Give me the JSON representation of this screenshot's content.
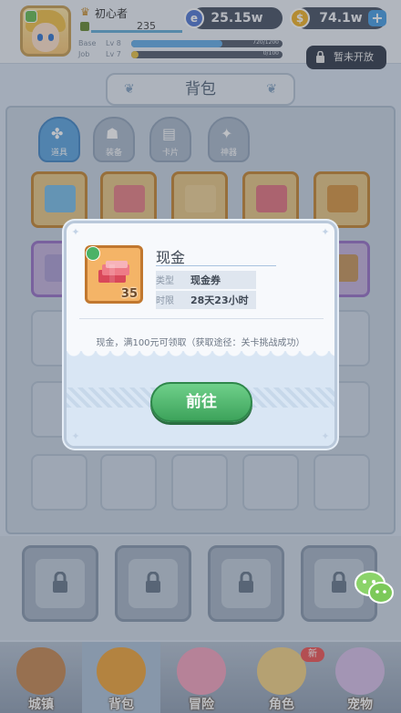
{
  "player": {
    "name": "初心者",
    "exp_value": "235"
  },
  "stats": [
    {
      "label": "Base",
      "level": "Lv 8",
      "bar_text": "720/1200",
      "fill": 0.6,
      "color": "#6ab0e8"
    },
    {
      "label": "Job",
      "level": "Lv 7",
      "bar_text": "0/100",
      "fill": 0.05,
      "color": "#e7c34c"
    }
  ],
  "currencies": [
    {
      "name": "diamond",
      "value": "25.15w",
      "icon": "e",
      "color": "#5a7fd6"
    },
    {
      "name": "gold",
      "value": "74.1w",
      "icon": "$",
      "color": "#f1b52e"
    }
  ],
  "locked_chip": "暂未开放",
  "bag": {
    "title": "背包"
  },
  "tabs": [
    {
      "label": "道具",
      "icon": "✤",
      "active": true
    },
    {
      "label": "装备",
      "icon": "☗",
      "active": false
    },
    {
      "label": "卡片",
      "icon": "▤",
      "active": false
    },
    {
      "label": "神器",
      "icon": "✦",
      "active": false
    }
  ],
  "modal": {
    "item_name": "现金",
    "quantity": "35",
    "type_label": "类型",
    "type_value": "现金券",
    "time_label": "时限",
    "time_value": "28天23小时",
    "description": "现金，满100元可领取（获取途径：关卡挑战成功）",
    "button_label": "前往"
  },
  "nav": [
    {
      "label": "城镇",
      "icon": "castle-icon",
      "active": false,
      "color": "#c78d5a"
    },
    {
      "label": "背包",
      "icon": "backpack-icon",
      "active": true,
      "color": "#f0a843"
    },
    {
      "label": "冒险",
      "icon": "poring-icon",
      "active": false,
      "color": "#f4a6c0"
    },
    {
      "label": "角色",
      "icon": "character-icon",
      "active": false,
      "color": "#f3d38a"
    },
    {
      "label": "宠物",
      "icon": "pet-icon",
      "active": false,
      "color": "#d9c2e8"
    }
  ],
  "nav_new_badge": "新"
}
